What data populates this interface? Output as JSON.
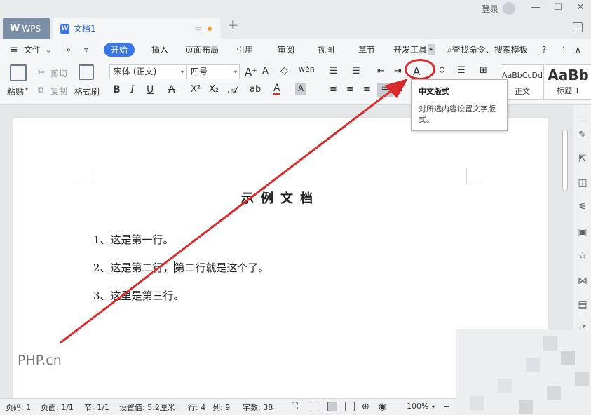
{
  "window": {
    "login": "登录",
    "min_icon": "minimize-icon",
    "max_icon": "maximize-icon",
    "close_icon": "close-icon"
  },
  "tabs": {
    "wps_label": "WPS",
    "wps_logo": "W",
    "doc_icon_letter": "W",
    "doc_label": "文档1",
    "new_tab": "+"
  },
  "menubar": {
    "file_label": "文件",
    "more": "»",
    "dropdown": "▿",
    "items": [
      "开始",
      "插入",
      "页面布局",
      "引用",
      "审阅",
      "视图",
      "章节",
      "开发工具"
    ],
    "search_cmd": "查找命令、搜索模板",
    "help": "?",
    "more_dots": "⋮",
    "collapse": "∧"
  },
  "ribbon": {
    "paste": "粘贴",
    "cut": "剪切",
    "copy": "复制",
    "format_painter": "格式刷",
    "font_name": "宋体 (正文)",
    "font_size": "四号",
    "bold": "B",
    "italic": "I",
    "underline": "U",
    "strike": "A",
    "superscript": "X²",
    "subscript": "X₂",
    "style_normal_sample": "AaBbCcDd",
    "style_normal_label": "正文",
    "style_h1_sample": "AaBb",
    "style_h1_label": "标题 1"
  },
  "tooltip": {
    "title": "中文版式",
    "desc": "对所选内容设置文字版式。"
  },
  "document": {
    "title": "示例文档",
    "line1": "1、这是第一行。",
    "line2_before": "2、这是第二行，",
    "line2_after": "第二行就是这个了。",
    "line3": "3、这里是第三行。"
  },
  "statusbar": {
    "page_num": "页码: 1",
    "pages": "页面: 1/1",
    "section": "节: 1/1",
    "setting": "设置值: 5.2厘米",
    "row": "行: 4",
    "col": "列: 9",
    "word_count": "字数: 38",
    "zoom": "100%",
    "zoom_minus": "−"
  },
  "watermark": "PHP.cn",
  "colors": {
    "accent": "#3b78e7",
    "annotation": "#d82b2b"
  }
}
